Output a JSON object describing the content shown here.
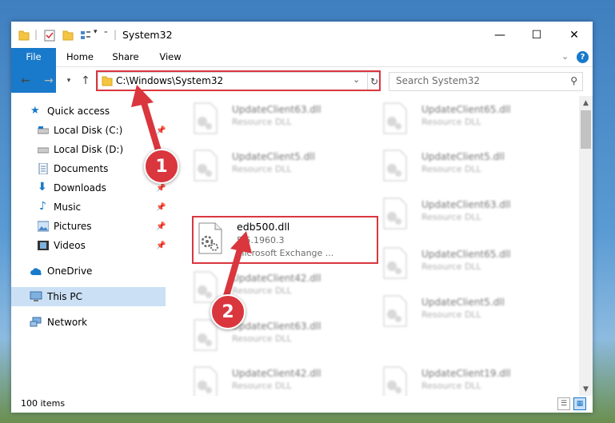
{
  "window": {
    "title": "System32",
    "minimize": "—",
    "maximize": "☐",
    "close": "✕"
  },
  "ribbon": {
    "tabs": [
      "File",
      "Home",
      "Share",
      "View"
    ]
  },
  "address": {
    "path": "C:\\Windows\\System32",
    "search_placeholder": "Search System32"
  },
  "sidebar": {
    "items": [
      {
        "label": "Quick access",
        "icon": "star-icon"
      },
      {
        "label": "Local Disk (C:)",
        "icon": "drive-icon"
      },
      {
        "label": "Local Disk (D:)",
        "icon": "drive-icon"
      },
      {
        "label": "Documents",
        "icon": "documents-icon"
      },
      {
        "label": "Downloads",
        "icon": "download-icon"
      },
      {
        "label": "Music",
        "icon": "music-icon"
      },
      {
        "label": "Pictures",
        "icon": "pictures-icon"
      },
      {
        "label": "Videos",
        "icon": "videos-icon"
      },
      {
        "label": "OneDrive",
        "icon": "cloud-icon"
      },
      {
        "label": "This PC",
        "icon": "computer-icon"
      },
      {
        "label": "Network",
        "icon": "network-icon"
      }
    ]
  },
  "files": {
    "left": [
      {
        "name": "UpdateClient63.dll",
        "type": "Resource DLL",
        "blurred": true
      },
      {
        "name": "UpdateClient5.dll",
        "type": "Resource DLL",
        "blurred": true
      },
      {
        "name": "edb500.dll",
        "version": "5.5.1960.3",
        "type": "Microsoft Exchange ...",
        "blurred": false
      },
      {
        "name": "UpdateClient42.dll",
        "type": "Resource DLL",
        "blurred": true
      },
      {
        "name": "UpdateClient63.dll",
        "type": "Resource DLL",
        "blurred": true
      },
      {
        "name": "UpdateClient42.dll",
        "type": "Resource DLL",
        "blurred": true
      }
    ],
    "right": [
      {
        "name": "UpdateClient65.dll",
        "type": "Resource DLL",
        "blurred": true
      },
      {
        "name": "UpdateClient5.dll",
        "type": "Resource DLL",
        "blurred": true
      },
      {
        "name": "UpdateClient63.dll",
        "type": "Resource DLL",
        "blurred": true
      },
      {
        "name": "UpdateClient65.dll",
        "type": "Resource DLL",
        "blurred": true
      },
      {
        "name": "UpdateClient5.dll",
        "type": "Resource DLL",
        "blurred": true
      },
      {
        "name": "UpdateClient19.dll",
        "type": "Resource DLL",
        "blurred": true
      }
    ]
  },
  "status": {
    "count": "100 items"
  },
  "annotations": {
    "step1": "1",
    "step2": "2",
    "color": "#d9363e"
  }
}
